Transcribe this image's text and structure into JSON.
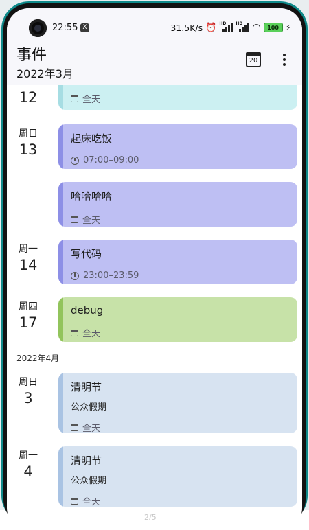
{
  "status_bar": {
    "time": "22:55",
    "app_icon": "X",
    "net_speed": "31.5K/s",
    "signal1_label": "HD",
    "signal2_label": "HD",
    "battery": "100"
  },
  "header": {
    "title": "事件",
    "subtitle": "2022年3月",
    "calendar_day": "20",
    "icons": {
      "calendar": "calendar-icon",
      "menu": "more-vertical-icon"
    }
  },
  "events": [
    {
      "weekday": "",
      "day": "12",
      "title": "",
      "sub": "",
      "meta": "全天",
      "meta_icon": "calendar",
      "color": "cyan"
    },
    {
      "weekday": "周日",
      "day": "13",
      "title": "起床吃饭",
      "sub": "",
      "meta": "07:00–09:00",
      "meta_icon": "clock",
      "color": "purple"
    },
    {
      "weekday": "",
      "day": "",
      "title": "哈哈哈哈",
      "sub": "",
      "meta": "全天",
      "meta_icon": "calendar",
      "color": "purple"
    },
    {
      "weekday": "周一",
      "day": "14",
      "title": "写代码",
      "sub": "",
      "meta": "23:00–23:59",
      "meta_icon": "clock",
      "color": "purple"
    },
    {
      "weekday": "周四",
      "day": "17",
      "title": "debug",
      "sub": "",
      "meta": "全天",
      "meta_icon": "calendar",
      "color": "green"
    }
  ],
  "month_separator": "2022年4月",
  "events_april": [
    {
      "weekday": "周日",
      "day": "3",
      "title": "清明节",
      "sub": "公众假期",
      "meta": "全天",
      "meta_icon": "calendar",
      "color": "blue"
    },
    {
      "weekday": "周一",
      "day": "4",
      "title": "清明节",
      "sub": "公众假期",
      "meta": "全天",
      "meta_icon": "calendar",
      "color": "blue"
    }
  ],
  "page_indicator": "2/5"
}
